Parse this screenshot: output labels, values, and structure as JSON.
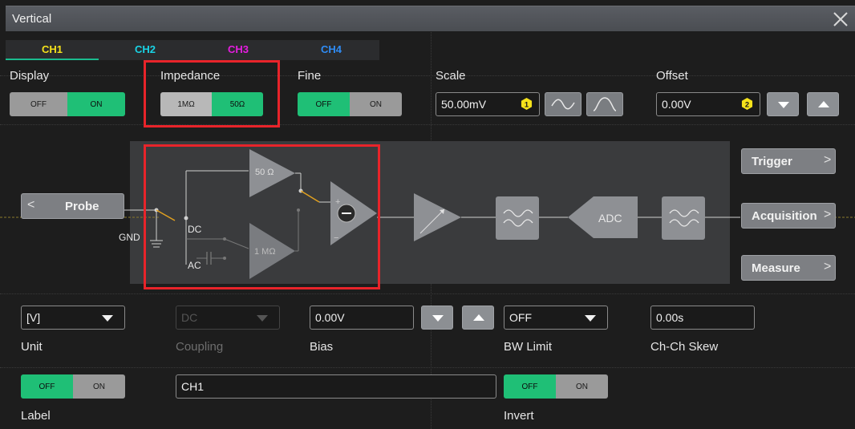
{
  "window": {
    "title": "Vertical"
  },
  "tabs": [
    {
      "label": "CH1",
      "color": "#f5e21b",
      "active": true
    },
    {
      "label": "CH2",
      "color": "#19d4e6",
      "active": false
    },
    {
      "label": "CH3",
      "color": "#e61de0",
      "active": false
    },
    {
      "label": "CH4",
      "color": "#2f8cf5",
      "active": false
    }
  ],
  "display": {
    "label": "Display",
    "off": "OFF",
    "on": "ON",
    "value": "ON"
  },
  "impedance": {
    "label": "Impedance",
    "opt1": "1MΩ",
    "opt2": "50Ω",
    "value": "50Ω"
  },
  "fine": {
    "label": "Fine",
    "off": "OFF",
    "on": "ON",
    "value": "OFF"
  },
  "scale": {
    "label": "Scale",
    "value": "50.00mV",
    "badge": "1"
  },
  "offset": {
    "label": "Offset",
    "value": "0.00V",
    "badge": "2"
  },
  "diagram": {
    "probe": "Probe",
    "gnd": "GND",
    "dc": "DC",
    "ac": "AC",
    "r50": "50 Ω",
    "r1m": "1 MΩ",
    "adc": "ADC",
    "plus": "+",
    "minus": "−"
  },
  "side": {
    "trigger": "Trigger",
    "acquisition": "Acquisition",
    "measure": "Measure"
  },
  "unit": {
    "label": "Unit",
    "value": "[V]"
  },
  "coupling": {
    "label": "Coupling",
    "value": "DC"
  },
  "bias": {
    "label": "Bias",
    "value": "0.00V"
  },
  "bw_limit": {
    "label": "BW Limit",
    "value": "OFF"
  },
  "skew": {
    "label": "Ch-Ch Skew",
    "value": "0.00s"
  },
  "label_toggle": {
    "label": "Label",
    "off": "OFF",
    "on": "ON",
    "value": "OFF"
  },
  "label_text": {
    "value": "CH1"
  },
  "invert": {
    "label": "Invert",
    "off": "OFF",
    "on": "ON",
    "value": "OFF"
  },
  "colors": {
    "accent": "#1fbf76",
    "highlight": "#e8242a",
    "badge": "#f5e21b"
  }
}
